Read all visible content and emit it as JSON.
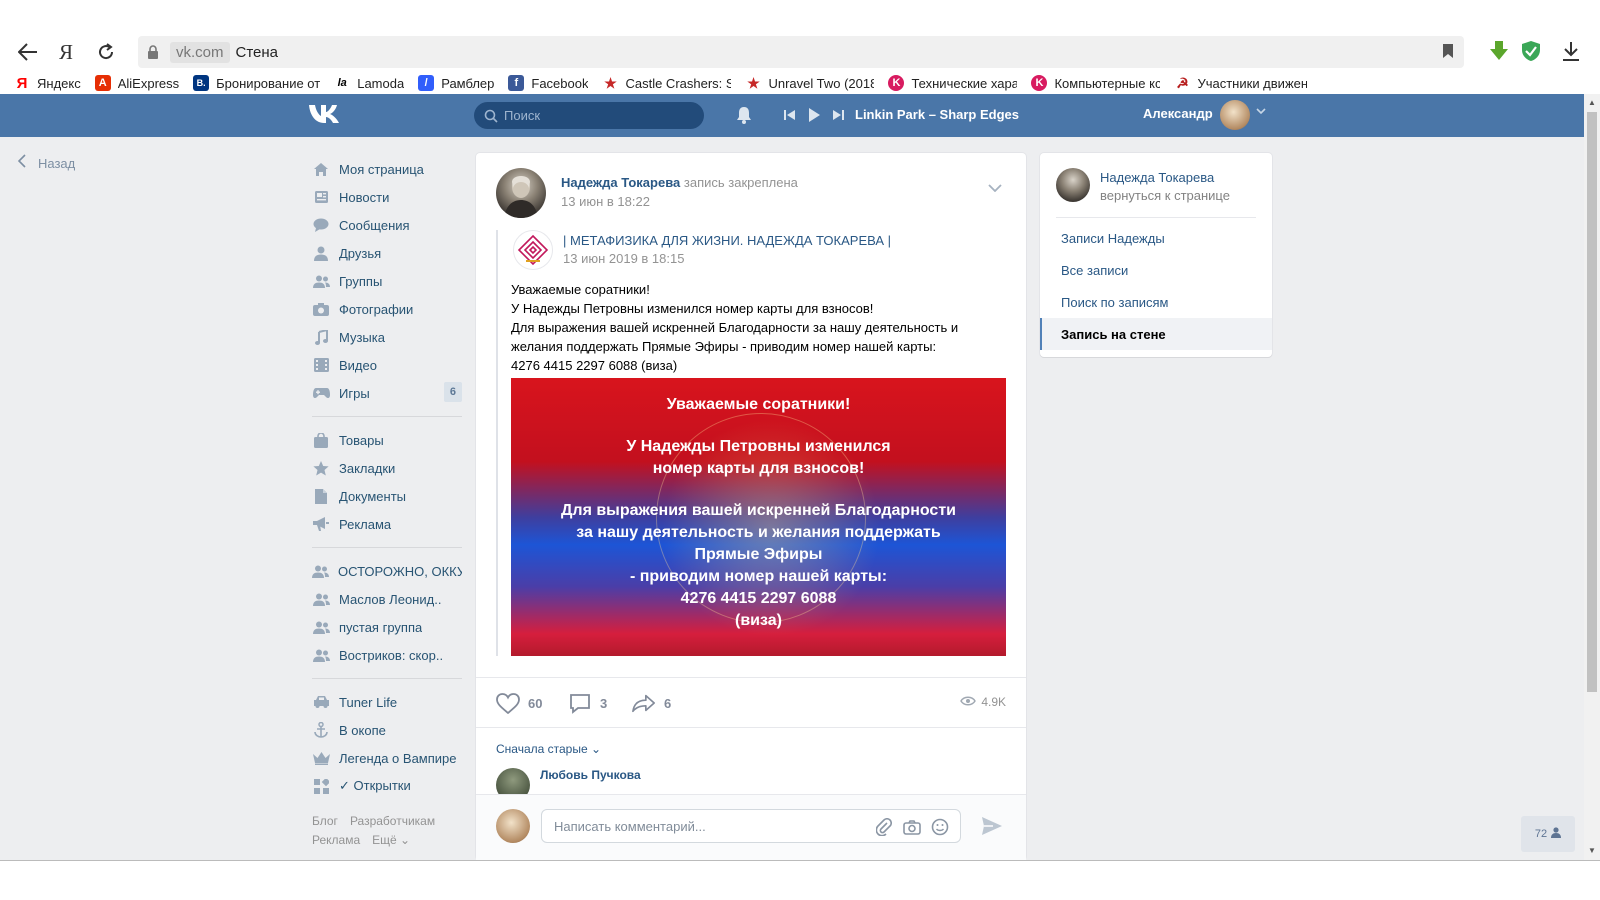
{
  "browser": {
    "host": "vk.com",
    "page_title": "Стена",
    "yandex_letter": "Я",
    "bookmarks": [
      {
        "label": "Яндекс",
        "color": "#ff0000",
        "glyph": "Я"
      },
      {
        "label": "AliExpress",
        "color": "#e62e04",
        "glyph": "A"
      },
      {
        "label": "Бронирование от",
        "color": "#003580",
        "glyph": "B."
      },
      {
        "label": "Lamoda",
        "color": "#000000",
        "glyph": "la"
      },
      {
        "label": "Рамблер",
        "color": "#315efb",
        "glyph": "/"
      },
      {
        "label": "Facebook",
        "color": "#3b5998",
        "glyph": "f"
      },
      {
        "label": "Castle Crashers: St",
        "color": "#c62828",
        "glyph": "★"
      },
      {
        "label": "Unravel Two (2018",
        "color": "#c62828",
        "glyph": "★"
      },
      {
        "label": "Технические хара",
        "color": "#d81b60",
        "glyph": "K"
      },
      {
        "label": "Компьютерные кс",
        "color": "#d81b60",
        "glyph": "K"
      },
      {
        "label": "Участники движен",
        "color": "#b71c1c",
        "glyph": "☭"
      }
    ]
  },
  "header": {
    "search_placeholder": "Поиск",
    "track": "Linkin Park – Sharp Edges",
    "user_name": "Александр"
  },
  "back_label": "Назад",
  "menu": {
    "group1": [
      {
        "label": "Моя страница",
        "icon": "home-icon"
      },
      {
        "label": "Новости",
        "icon": "news-icon"
      },
      {
        "label": "Сообщения",
        "icon": "messages-icon"
      },
      {
        "label": "Друзья",
        "icon": "friends-icon"
      },
      {
        "label": "Группы",
        "icon": "groups-icon"
      },
      {
        "label": "Фотографии",
        "icon": "camera-icon"
      },
      {
        "label": "Музыка",
        "icon": "music-icon"
      },
      {
        "label": "Видео",
        "icon": "video-icon"
      },
      {
        "label": "Игры",
        "icon": "games-icon",
        "count": "6"
      }
    ],
    "group2": [
      {
        "label": "Товары",
        "icon": "bag-icon"
      },
      {
        "label": "Закладки",
        "icon": "star-icon"
      },
      {
        "label": "Документы",
        "icon": "document-icon"
      },
      {
        "label": "Реклама",
        "icon": "megaphone-icon"
      }
    ],
    "group3": [
      {
        "label": "ОСТОРОЖНО, ОККУ..",
        "icon": "groups-icon"
      },
      {
        "label": "Маслов Леонид..",
        "icon": "groups-icon"
      },
      {
        "label": "пустая группа",
        "icon": "groups-icon"
      },
      {
        "label": "Востриков: скор..",
        "icon": "groups-icon"
      }
    ],
    "group4": [
      {
        "label": "Tuner Life",
        "icon": "car-icon"
      },
      {
        "label": "В окопе",
        "icon": "anchor-icon"
      },
      {
        "label": "Легенда о Вампире",
        "icon": "crown-icon"
      },
      {
        "label": "✓ Открытки",
        "icon": "apps-icon"
      }
    ],
    "footer": [
      "Блог",
      "Разработчикам",
      "Реклама",
      "Ещё ⌄"
    ]
  },
  "post": {
    "author": "Надежда Токарева",
    "pinned_note": "запись закреплена",
    "date": "13 июн в 18:22",
    "source_name": "| МЕТАФИЗИКА ДЛЯ ЖИЗНИ. НАДЕЖДА ТОКАРЕВА |",
    "source_date": "13 июн 2019 в 18:15",
    "text_lines": [
      "Уважаемые соратники!",
      "У Надежды Петровны изменился номер карты для взносов!",
      "Для выражения вашей искренней Благодарности за нашу деятельность и",
      "желания поддержать Прямые Эфиры - приводим номер нашей карты:",
      "4276 4415 2297 6088 (виза)"
    ],
    "image_lines": [
      "Уважаемые соратники!",
      "",
      "У Надежды Петровны изменился",
      "номер карты для взносов!",
      "",
      "Для выражения вашей искренней Благодарности",
      "за нашу деятельность и желания поддержать",
      "Прямые Эфиры",
      "- приводим номер нашей карты:",
      "4276 4415 2297 6088",
      "(виза)"
    ],
    "likes": "60",
    "comments": "3",
    "shares": "6",
    "views": "4.9K"
  },
  "comments": {
    "sort_label": "Сначала старые ⌄",
    "first_author": "Любовь Пучкова",
    "input_placeholder": "Написать комментарий..."
  },
  "right_card": {
    "name": "Надежда Токарева",
    "back_text": "вернуться к странице",
    "items": [
      {
        "label": "Записи Надежды",
        "active": false
      },
      {
        "label": "Все записи",
        "active": false
      },
      {
        "label": "Поиск по записям",
        "active": false
      },
      {
        "label": "Запись на стене",
        "active": true
      }
    ]
  },
  "online_count": "72",
  "colors": {
    "vk_blue": "#4a76a8",
    "link": "#2a5885",
    "page_bg": "#edeef0"
  }
}
